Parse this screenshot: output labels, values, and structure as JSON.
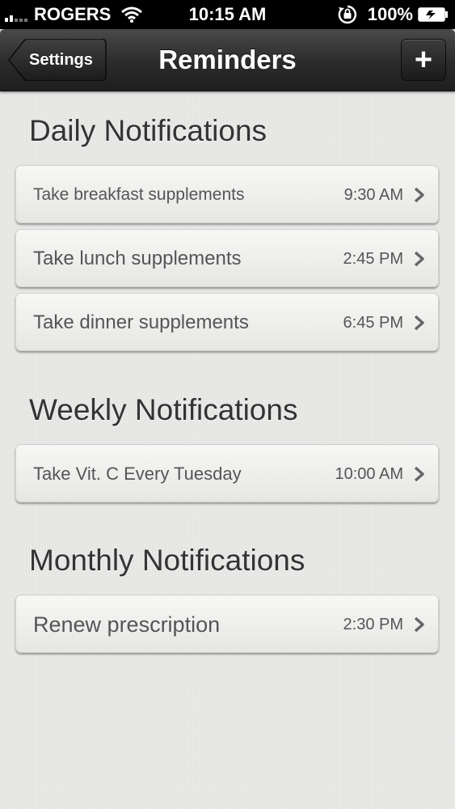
{
  "status_bar": {
    "carrier": "ROGERS",
    "time": "10:15 AM",
    "battery": "100%",
    "signal_icon": "signal-bars-icon",
    "wifi_icon": "wifi-icon",
    "rotation_lock_icon": "rotation-lock-icon",
    "battery_icon": "battery-icon"
  },
  "nav": {
    "back_label": "Settings",
    "title": "Reminders",
    "add_label": "+"
  },
  "sections": [
    {
      "title": "Daily Notifications",
      "items": [
        {
          "label": "Take breakfast supplements",
          "time": "9:30 AM"
        },
        {
          "label": "Take lunch supplements",
          "time": "2:45 PM"
        },
        {
          "label": "Take dinner supplements",
          "time": "6:45 PM"
        }
      ]
    },
    {
      "title": "Weekly Notifications",
      "items": [
        {
          "label": "Take Vit. C Every Tuesday",
          "time": "10:00 AM"
        }
      ]
    },
    {
      "title": "Monthly Notifications",
      "items": [
        {
          "label": "Renew prescription",
          "time": "2:30 PM"
        }
      ]
    }
  ],
  "colors": {
    "background": "#e7e7e5",
    "nav_bar": "#2b2b2b",
    "text": "#555555"
  }
}
